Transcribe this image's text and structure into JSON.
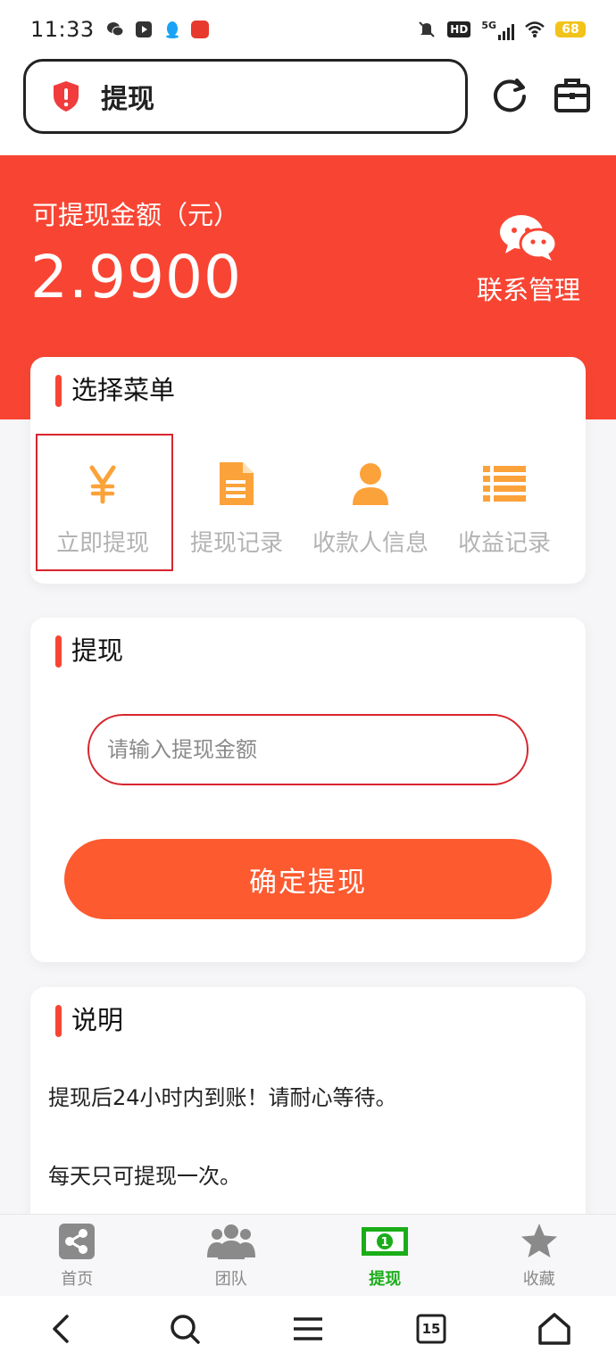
{
  "status_bar": {
    "time": "11:33",
    "signal_label": "5G",
    "hd_label": "HD",
    "battery": "68"
  },
  "browser": {
    "title": "提现"
  },
  "hero": {
    "label": "可提现金额（元）",
    "amount": "2.9900",
    "contact_label": "联系管理"
  },
  "menu_card": {
    "title": "选择菜单",
    "items": [
      {
        "label": "立即提现",
        "icon": "yuan-icon",
        "selected": true
      },
      {
        "label": "提现记录",
        "icon": "document-icon"
      },
      {
        "label": "收款人信息",
        "icon": "person-icon"
      },
      {
        "label": "收益记录",
        "icon": "list-icon"
      }
    ]
  },
  "withdraw_card": {
    "title": "提现",
    "input_placeholder": "请输入提现金额",
    "button_label": "确定提现"
  },
  "notes_card": {
    "title": "说明",
    "lines": [
      "提现后24小时内到账！请耐心等待。",
      "每天只可提现一次。"
    ]
  },
  "tabbar": [
    {
      "label": "首页",
      "icon": "share-icon"
    },
    {
      "label": "团队",
      "icon": "group-icon"
    },
    {
      "label": "提现",
      "icon": "money-icon",
      "active": true
    },
    {
      "label": "收藏",
      "icon": "star-icon"
    }
  ],
  "sysnav": {
    "tabs_count": "15"
  },
  "colors": {
    "brand_red": "#f84533",
    "button_orange": "#fd5a30",
    "menu_icon_orange": "#fca23a",
    "active_tab_green": "#1aad19"
  }
}
